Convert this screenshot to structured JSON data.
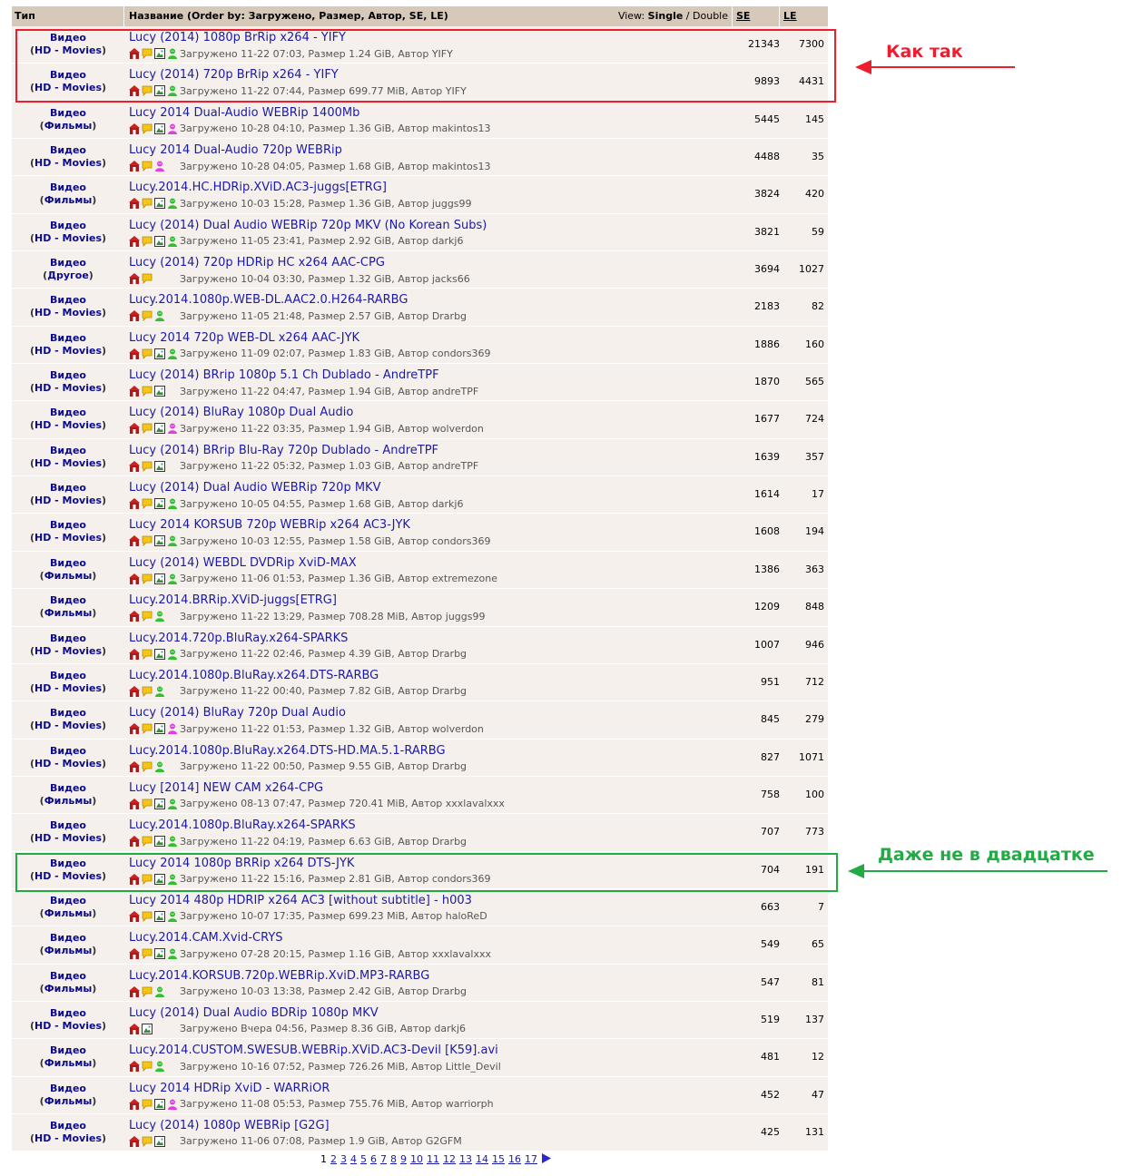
{
  "header": {
    "type_label": "Тип",
    "name_label": "Название (Order by: Загружено, Размер, Автор, SE, LE)",
    "view_prefix": "View: ",
    "view_single": "Single",
    "view_sep": " / ",
    "view_double": "Double",
    "se_label": "SE",
    "le_label": "LE"
  },
  "rows": [
    {
      "cat": "Видео",
      "sub": "HD - Movies",
      "title": "Lucy (2014) 1080p BrRip x264 - YIFY",
      "icons": [
        "house",
        "comment",
        "image",
        "user-green"
      ],
      "info": "Загружено 11-22 07:03, Размер 1.24 GiB, Автор YIFY",
      "se": "21343",
      "le": "7300"
    },
    {
      "cat": "Видео",
      "sub": "HD - Movies",
      "title": "Lucy (2014) 720p BrRip x264 - YIFY",
      "icons": [
        "house",
        "comment",
        "image",
        "user-green"
      ],
      "info": "Загружено 11-22 07:44, Размер 699.77 MiB, Автор YIFY",
      "se": "9893",
      "le": "4431"
    },
    {
      "cat": "Видео",
      "sub": "Фильмы",
      "title": "Lucy 2014 Dual-Audio WEBRip 1400Mb",
      "icons": [
        "house",
        "comment",
        "image",
        "user-pink"
      ],
      "info": "Загружено 10-28 04:10, Размер 1.36 GiB, Автор makintos13",
      "se": "5445",
      "le": "145"
    },
    {
      "cat": "Видео",
      "sub": "HD - Movies",
      "title": "Lucy 2014 Dual-Audio 720p WEBRip",
      "icons": [
        "house",
        "comment",
        "user-pink"
      ],
      "info": "Загружено 10-28 04:05, Размер 1.68 GiB, Автор makintos13",
      "se": "4488",
      "le": "35"
    },
    {
      "cat": "Видео",
      "sub": "Фильмы",
      "title": "Lucy.2014.HC.HDRip.XViD.AC3-juggs[ETRG]",
      "icons": [
        "house",
        "comment",
        "image",
        "user-green"
      ],
      "info": "Загружено 10-03 15:28, Размер 1.36 GiB, Автор juggs99",
      "se": "3824",
      "le": "420"
    },
    {
      "cat": "Видео",
      "sub": "HD - Movies",
      "title": "Lucy (2014) Dual Audio WEBRip 720p MKV (No Korean Subs)",
      "icons": [
        "house",
        "comment",
        "image",
        "user-green"
      ],
      "info": "Загружено 11-05 23:41, Размер 2.92 GiB, Автор darkj6",
      "se": "3821",
      "le": "59"
    },
    {
      "cat": "Видео",
      "sub": "Другое",
      "title": "Lucy (2014) 720p HDRip HC x264 AAC-CPG",
      "icons": [
        "house",
        "comment"
      ],
      "info": "Загружено 10-04 03:30, Размер 1.32 GiB, Автор jacks66",
      "se": "3694",
      "le": "1027"
    },
    {
      "cat": "Видео",
      "sub": "HD - Movies",
      "title": "Lucy.2014.1080p.WEB-DL.AAC2.0.H264-RARBG",
      "icons": [
        "house",
        "comment",
        "user-green"
      ],
      "info": "Загружено 11-05 21:48, Размер 2.57 GiB, Автор Drarbg",
      "se": "2183",
      "le": "82"
    },
    {
      "cat": "Видео",
      "sub": "HD - Movies",
      "title": "Lucy 2014 720p WEB-DL x264 AAC-JYK",
      "icons": [
        "house",
        "comment",
        "image",
        "user-green"
      ],
      "info": "Загружено 11-09 02:07, Размер 1.83 GiB, Автор condors369",
      "se": "1886",
      "le": "160"
    },
    {
      "cat": "Видео",
      "sub": "HD - Movies",
      "title": "Lucy (2014) BRrip 1080p 5.1 Ch Dublado - AndreTPF",
      "icons": [
        "house",
        "comment",
        "image"
      ],
      "info": "Загружено 11-22 04:47, Размер 1.94 GiB, Автор andreTPF",
      "se": "1870",
      "le": "565"
    },
    {
      "cat": "Видео",
      "sub": "HD - Movies",
      "title": "Lucy (2014) BluRay 1080p Dual Audio",
      "icons": [
        "house",
        "comment",
        "image",
        "user-pink"
      ],
      "info": "Загружено 11-22 03:35, Размер 1.94 GiB, Автор wolverdon",
      "se": "1677",
      "le": "724"
    },
    {
      "cat": "Видео",
      "sub": "HD - Movies",
      "title": "Lucy (2014) BRrip Blu-Ray 720p Dublado - AndreTPF",
      "icons": [
        "house",
        "comment",
        "image"
      ],
      "info": "Загружено 11-22 05:32, Размер 1.03 GiB, Автор andreTPF",
      "se": "1639",
      "le": "357"
    },
    {
      "cat": "Видео",
      "sub": "HD - Movies",
      "title": "Lucy (2014) Dual Audio WEBRip 720p MKV",
      "icons": [
        "house",
        "comment",
        "image",
        "user-green"
      ],
      "info": "Загружено 10-05 04:55, Размер 1.68 GiB, Автор darkj6",
      "se": "1614",
      "le": "17"
    },
    {
      "cat": "Видео",
      "sub": "HD - Movies",
      "title": "Lucy 2014 KORSUB 720p WEBRip x264 AC3-JYK",
      "icons": [
        "house",
        "comment",
        "image",
        "user-green"
      ],
      "info": "Загружено 10-03 12:55, Размер 1.58 GiB, Автор condors369",
      "se": "1608",
      "le": "194"
    },
    {
      "cat": "Видео",
      "sub": "Фильмы",
      "title": "Lucy (2014) WEBDL DVDRip XviD-MAX",
      "icons": [
        "house",
        "comment",
        "image",
        "user-green"
      ],
      "info": "Загружено 11-06 01:53, Размер 1.36 GiB, Автор extremezone",
      "se": "1386",
      "le": "363"
    },
    {
      "cat": "Видео",
      "sub": "Фильмы",
      "title": "Lucy.2014.BRRip.XViD-juggs[ETRG]",
      "icons": [
        "house",
        "comment",
        "user-green"
      ],
      "info": "Загружено 11-22 13:29, Размер 708.28 MiB, Автор juggs99",
      "se": "1209",
      "le": "848"
    },
    {
      "cat": "Видео",
      "sub": "HD - Movies",
      "title": "Lucy.2014.720p.BluRay.x264-SPARKS",
      "icons": [
        "house",
        "comment",
        "image",
        "user-green"
      ],
      "info": "Загружено 11-22 02:46, Размер 4.39 GiB, Автор Drarbg",
      "se": "1007",
      "le": "946"
    },
    {
      "cat": "Видео",
      "sub": "HD - Movies",
      "title": "Lucy.2014.1080p.BluRay.x264.DTS-RARBG",
      "icons": [
        "house",
        "comment",
        "user-green"
      ],
      "info": "Загружено 11-22 00:40, Размер 7.82 GiB, Автор Drarbg",
      "se": "951",
      "le": "712"
    },
    {
      "cat": "Видео",
      "sub": "HD - Movies",
      "title": "Lucy (2014) BluRay 720p Dual Audio",
      "icons": [
        "house",
        "comment",
        "image",
        "user-pink"
      ],
      "info": "Загружено 11-22 01:53, Размер 1.32 GiB, Автор wolverdon",
      "se": "845",
      "le": "279"
    },
    {
      "cat": "Видео",
      "sub": "HD - Movies",
      "title": "Lucy.2014.1080p.BluRay.x264.DTS-HD.MA.5.1-RARBG",
      "icons": [
        "house",
        "comment",
        "user-green"
      ],
      "info": "Загружено 11-22 00:50, Размер 9.55 GiB, Автор Drarbg",
      "se": "827",
      "le": "1071"
    },
    {
      "cat": "Видео",
      "sub": "Фильмы",
      "title": "Lucy [2014] NEW CAM x264-CPG",
      "icons": [
        "house",
        "comment",
        "image",
        "user-green"
      ],
      "info": "Загружено 08-13 07:47, Размер 720.41 MiB, Автор xxxlavalxxx",
      "se": "758",
      "le": "100"
    },
    {
      "cat": "Видео",
      "sub": "HD - Movies",
      "title": "Lucy.2014.1080p.BluRay.x264-SPARKS",
      "icons": [
        "house",
        "comment",
        "image",
        "user-green"
      ],
      "info": "Загружено 11-22 04:19, Размер 6.63 GiB, Автор Drarbg",
      "se": "707",
      "le": "773"
    },
    {
      "cat": "Видео",
      "sub": "HD - Movies",
      "title": "Lucy 2014 1080p BRRip x264 DTS-JYK",
      "icons": [
        "house",
        "comment",
        "image",
        "user-green"
      ],
      "info": "Загружено 11-22 15:16, Размер 2.81 GiB, Автор condors369",
      "se": "704",
      "le": "191"
    },
    {
      "cat": "Видео",
      "sub": "Фильмы",
      "title": "Lucy 2014 480p HDRIP x264 AC3 [without subtitle] - h003",
      "icons": [
        "house",
        "comment",
        "image",
        "user-green"
      ],
      "info": "Загружено 10-07 17:35, Размер 699.23 MiB, Автор haloReD",
      "se": "663",
      "le": "7"
    },
    {
      "cat": "Видео",
      "sub": "Фильмы",
      "title": "Lucy.2014.CAM.Xvid-CRYS",
      "icons": [
        "house",
        "comment",
        "image",
        "user-green"
      ],
      "info": "Загружено 07-28 20:15, Размер 1.16 GiB, Автор xxxlavalxxx",
      "se": "549",
      "le": "65"
    },
    {
      "cat": "Видео",
      "sub": "Фильмы",
      "title": "Lucy.2014.KORSUB.720p.WEBRip.XviD.MP3-RARBG",
      "icons": [
        "house",
        "comment",
        "user-green"
      ],
      "info": "Загружено 10-03 13:38, Размер 2.42 GiB, Автор Drarbg",
      "se": "547",
      "le": "81"
    },
    {
      "cat": "Видео",
      "sub": "HD - Movies",
      "title": "Lucy (2014) Dual Audio BDRip 1080p MKV",
      "icons": [
        "house",
        "image"
      ],
      "info": "Загружено Вчера 04:56, Размер 8.36 GiB, Автор darkj6",
      "se": "519",
      "le": "137"
    },
    {
      "cat": "Видео",
      "sub": "Фильмы",
      "title": "Lucy.2014.CUSTOM.SWESUB.WEBRip.XViD.AC3-Devil [K59].avi",
      "icons": [
        "house",
        "comment",
        "user-green"
      ],
      "info": "Загружено 10-16 07:52, Размер 726.26 MiB, Автор Little_Devil",
      "se": "481",
      "le": "12"
    },
    {
      "cat": "Видео",
      "sub": "Фильмы",
      "title": "Lucy 2014 HDRip XviD - WARRiOR",
      "icons": [
        "house",
        "comment",
        "image",
        "user-pink"
      ],
      "info": "Загружено 11-08 05:53, Размер 755.76 MiB, Автор warriorph",
      "se": "452",
      "le": "47"
    },
    {
      "cat": "Видео",
      "sub": "HD - Movies",
      "title": "Lucy (2014) 1080p WEBRip [G2G]",
      "icons": [
        "house",
        "comment",
        "image"
      ],
      "info": "Загружено 11-06 07:08, Размер 1.9 GiB, Автор G2GFM",
      "se": "425",
      "le": "131"
    }
  ],
  "pager": {
    "current": "1",
    "pages": [
      "2",
      "3",
      "4",
      "5",
      "6",
      "7",
      "8",
      "9",
      "10",
      "11",
      "12",
      "13",
      "14",
      "15",
      "16",
      "17"
    ],
    "next_icon": "next-arrow-icon"
  },
  "annotations": {
    "red_label": "Как так",
    "green_label": "Даже не в двадцатке",
    "red_color": "#ee1c2f",
    "green_color": "#22aa44"
  },
  "colors": {
    "header_bg": "#d6c9b9",
    "row_bg": "#f6f0ec",
    "link": "#1a1aa8",
    "category": "#0b0b8a"
  }
}
